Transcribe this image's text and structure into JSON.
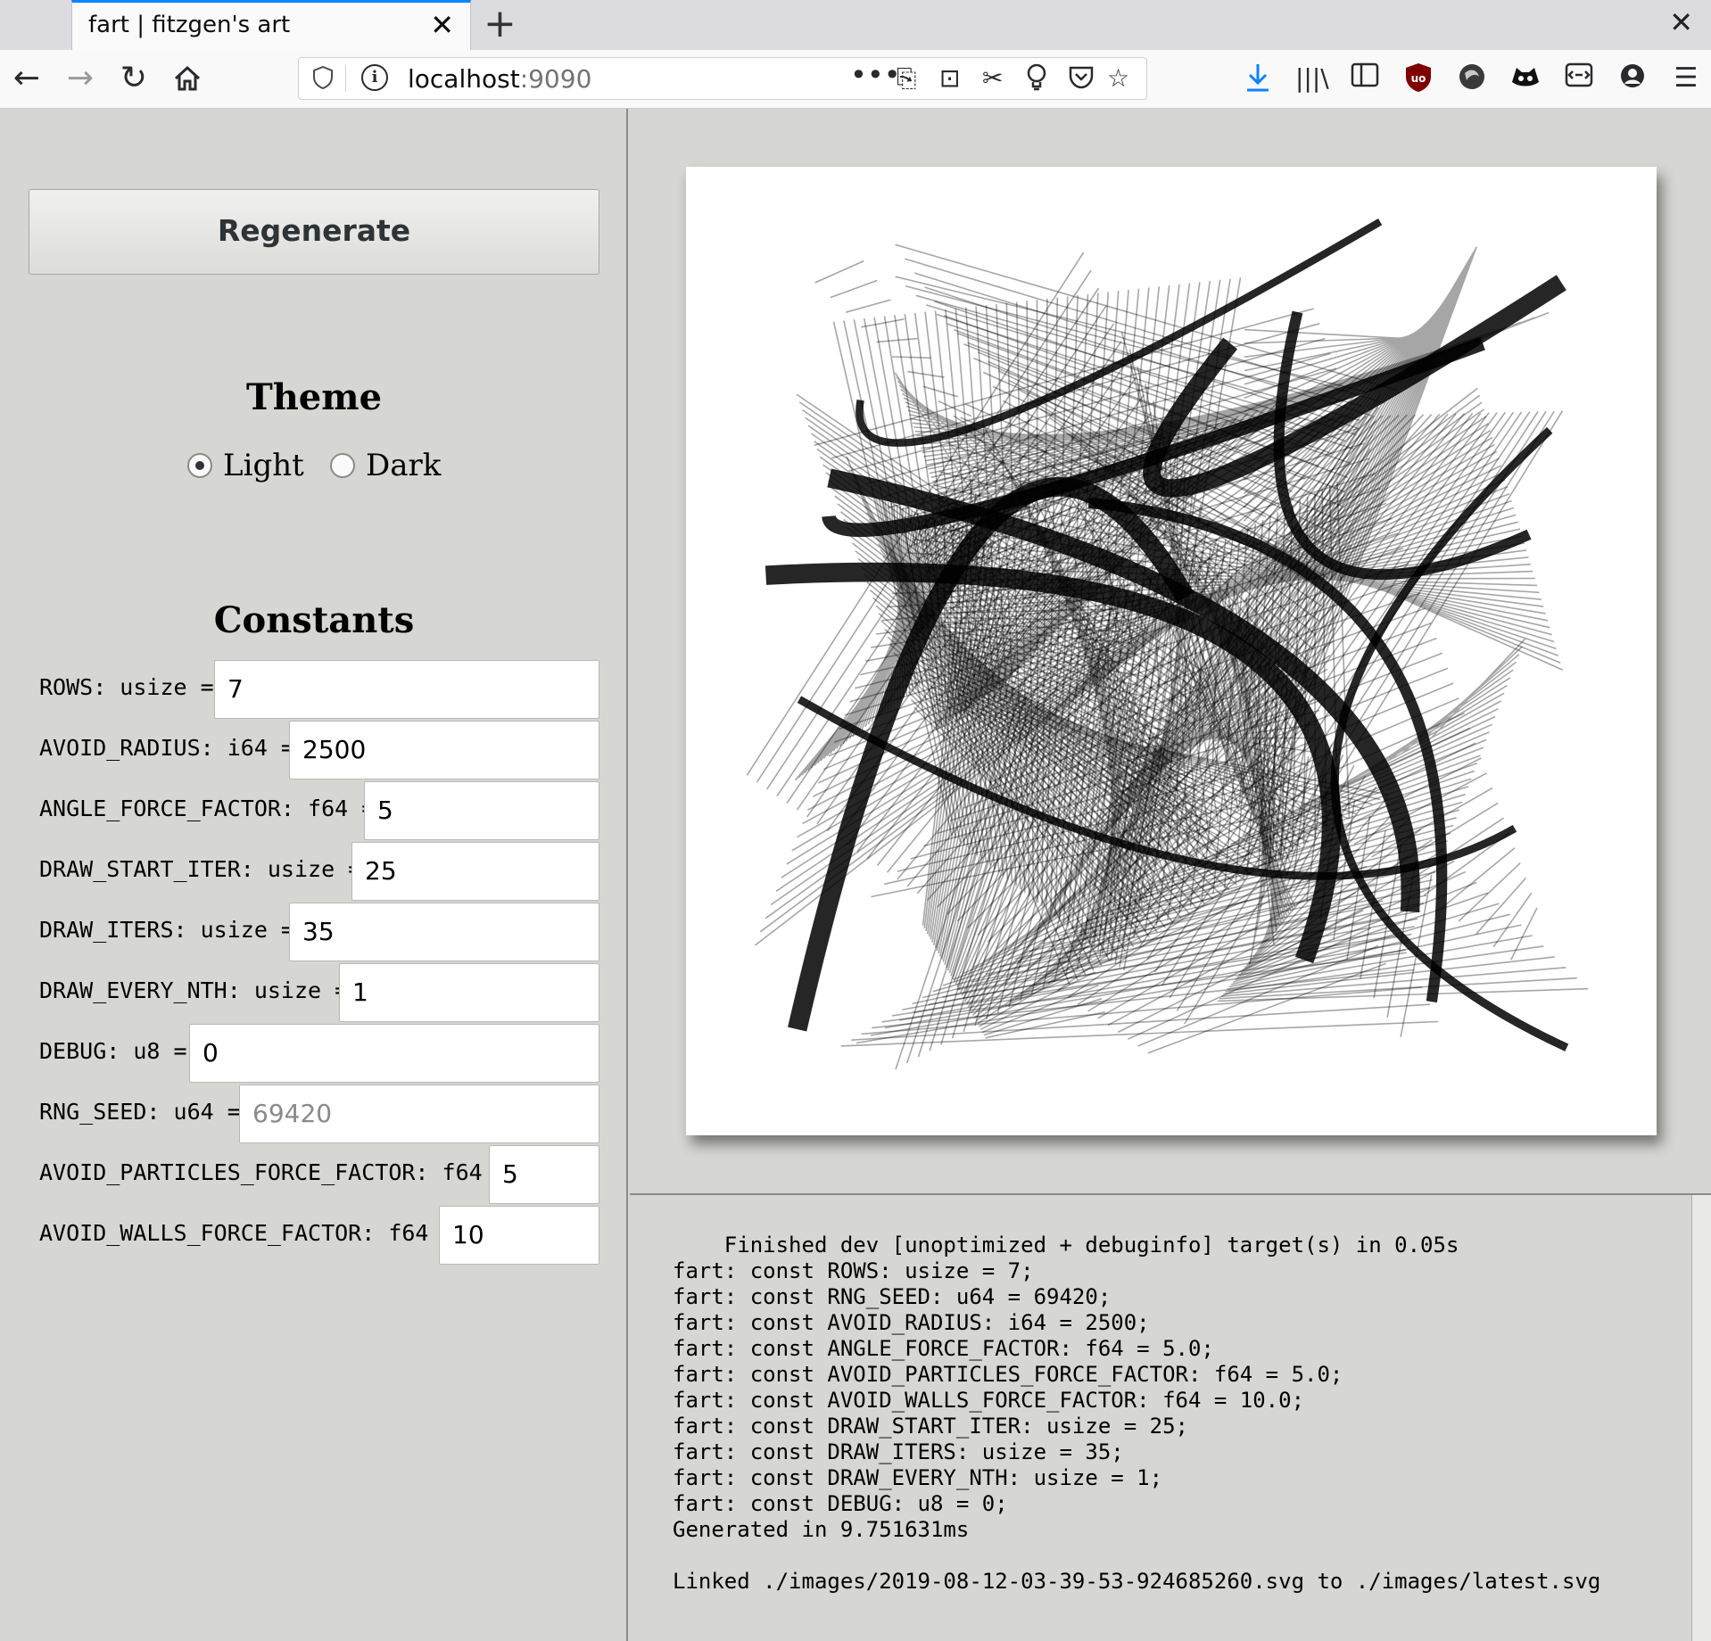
{
  "browser": {
    "tab_title": "fart | fitzgen's art",
    "url_host": "localhost",
    "url_port": ":9090"
  },
  "controls": {
    "regenerate_label": "Regenerate",
    "theme_title": "Theme",
    "theme_options": [
      {
        "label": "Light",
        "selected": true
      },
      {
        "label": "Dark",
        "selected": false
      }
    ],
    "constants_title": "Constants",
    "constants": [
      {
        "label": "ROWS: usize = ",
        "value": "7",
        "placeholder": ""
      },
      {
        "label": "AVOID_RADIUS: i64 = ",
        "value": "2500",
        "placeholder": ""
      },
      {
        "label": "ANGLE_FORCE_FACTOR: f64 = ",
        "value": "5",
        "placeholder": ""
      },
      {
        "label": "DRAW_START_ITER: usize = ",
        "value": "25",
        "placeholder": ""
      },
      {
        "label": "DRAW_ITERS: usize = ",
        "value": "35",
        "placeholder": ""
      },
      {
        "label": "DRAW_EVERY_NTH: usize = ",
        "value": "1",
        "placeholder": ""
      },
      {
        "label": "DEBUG: u8 = ",
        "value": "0",
        "placeholder": ""
      },
      {
        "label": "RNG_SEED: u64 = ",
        "value": "",
        "placeholder": "69420"
      },
      {
        "label": "AVOID_PARTICLES_FORCE_FACTOR: f64 = ",
        "value": "5",
        "placeholder": ""
      },
      {
        "label": "AVOID_WALLS_FORCE_FACTOR: f64 = ",
        "value": "10",
        "placeholder": ""
      }
    ]
  },
  "log": {
    "lines": [
      "    Finished dev [unoptimized + debuginfo] target(s) in 0.05s",
      "fart: const ROWS: usize = 7;",
      "fart: const RNG_SEED: u64 = 69420;",
      "fart: const AVOID_RADIUS: i64 = 2500;",
      "fart: const ANGLE_FORCE_FACTOR: f64 = 5.0;",
      "fart: const AVOID_PARTICLES_FORCE_FACTOR: f64 = 5.0;",
      "fart: const AVOID_WALLS_FORCE_FACTOR: f64 = 10.0;",
      "fart: const DRAW_START_ITER: usize = 25;",
      "fart: const DRAW_ITERS: usize = 35;",
      "fart: const DRAW_EVERY_NTH: usize = 1;",
      "fart: const DEBUG: u8 = 0;",
      "Generated in 9.751631ms",
      "",
      "Linked ./images/2019-08-12-03-39-53-924685260.svg to ./images/latest.svg"
    ]
  },
  "icons": {
    "back": "back-arrow-icon",
    "forward": "forward-arrow-icon",
    "reload": "reload-icon",
    "home": "home-icon"
  }
}
